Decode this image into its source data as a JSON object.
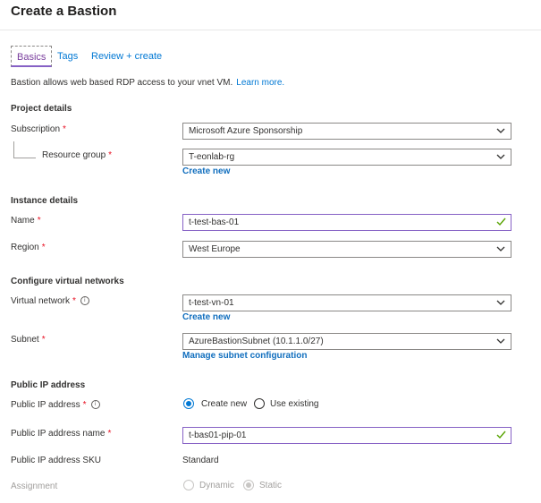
{
  "page": {
    "title": "Create a Bastion"
  },
  "tabs": [
    {
      "label": "Basics"
    },
    {
      "label": "Tags"
    },
    {
      "label": "Review + create"
    }
  ],
  "intro": {
    "text": "Bastion allows web based RDP access to your vnet VM.",
    "link": "Learn more."
  },
  "project": {
    "heading": "Project details",
    "subscription": {
      "label": "Subscription",
      "value": "Microsoft Azure Sponsorship"
    },
    "resource_group": {
      "label": "Resource group",
      "value": "T-eonlab-rg",
      "create_link": "Create new"
    }
  },
  "instance": {
    "heading": "Instance details",
    "name": {
      "label": "Name",
      "value": "t-test-bas-01"
    },
    "region": {
      "label": "Region",
      "value": "West Europe"
    }
  },
  "network": {
    "heading": "Configure virtual networks",
    "vnet": {
      "label": "Virtual network",
      "value": "t-test-vn-01",
      "create_link": "Create new"
    },
    "subnet": {
      "label": "Subnet",
      "value": "AzureBastionSubnet (10.1.1.0/27)",
      "manage_link": "Manage subnet configuration"
    }
  },
  "public_ip": {
    "heading": "Public IP address",
    "address": {
      "label": "Public IP address",
      "option_new": "Create new",
      "option_existing": "Use existing",
      "selected": "Create new"
    },
    "name": {
      "label": "Public IP address name",
      "value": "t-bas01-pip-01"
    },
    "sku": {
      "label": "Public IP address SKU",
      "value": "Standard"
    },
    "assignment": {
      "label": "Assignment",
      "option_dynamic": "Dynamic",
      "option_static": "Static",
      "selected": "Static"
    }
  },
  "colors": {
    "accent": "#0078d4",
    "valid_border": "#8661c5",
    "required": "#e81123",
    "check": "#57a300"
  },
  "icons": {
    "dropdown": "chevron-down-icon",
    "valid": "checkmark-icon",
    "info": "info-icon"
  }
}
